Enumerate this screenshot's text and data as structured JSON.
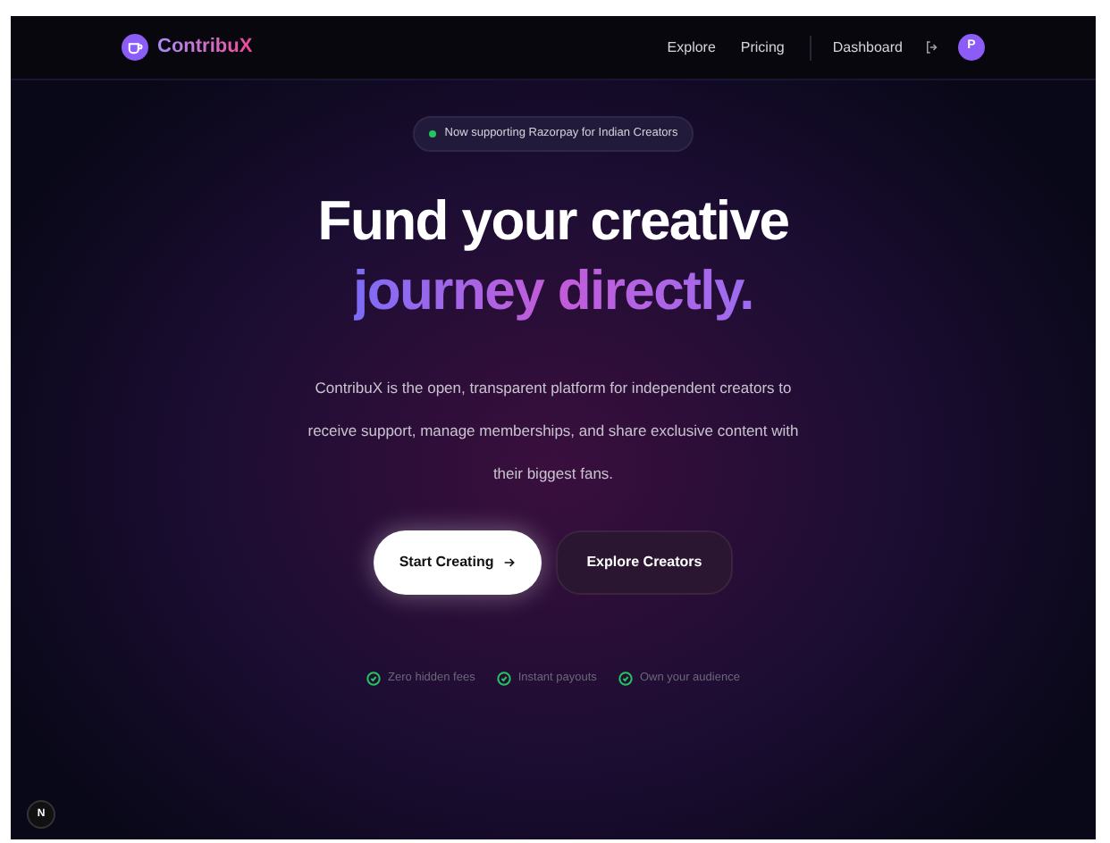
{
  "brand": {
    "name": "ContribuX"
  },
  "nav": {
    "links": [
      "Explore",
      "Pricing"
    ],
    "dashboard": "Dashboard",
    "avatar": "P"
  },
  "announcement": {
    "text": "Now supporting Razorpay for Indian Creators"
  },
  "headline": {
    "line_1": "Fund your creative",
    "line_2": "journey directly."
  },
  "description": "ContribuX is the open, transparent platform for independent creators to receive support, manage memberships, and share exclusive content with their biggest fans.",
  "buttons": [
    {
      "label": "Start Creating",
      "kind": "primary"
    },
    {
      "label": "Explore Creators",
      "kind": "secondary"
    }
  ],
  "features": [
    "Zero hidden fees",
    "Instant payouts",
    "Own your audience"
  ],
  "dev_badge": "N"
}
